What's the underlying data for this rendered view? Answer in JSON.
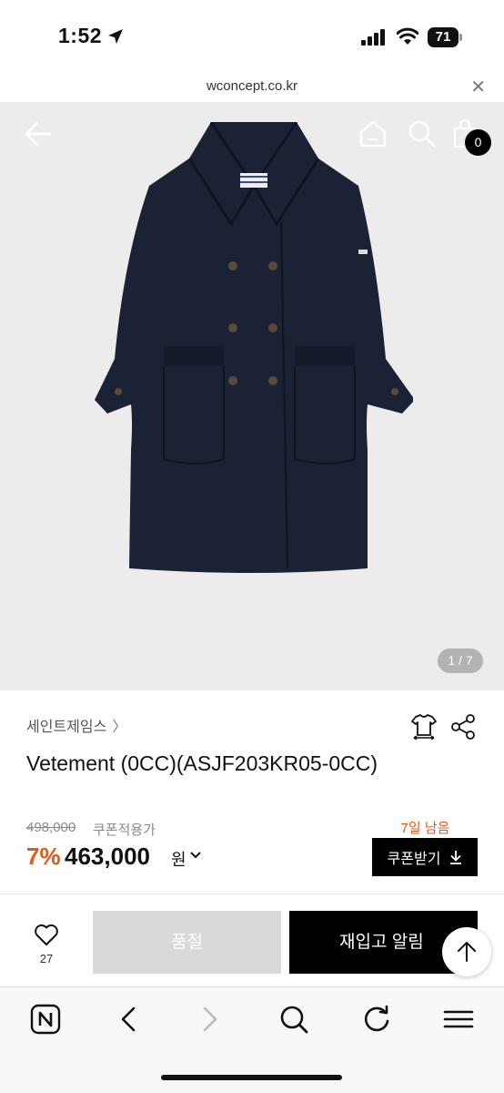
{
  "status": {
    "time": "1:52",
    "battery": "71"
  },
  "browser": {
    "url": "wconcept.co.kr",
    "close_glyph": "✕"
  },
  "gallery": {
    "cart_count": "0",
    "page_counter": "1 / 7"
  },
  "product": {
    "brand": "세인트제임스",
    "brand_chevron": "〉",
    "name": "Vetement (0CC)(ASJF203KR05-0CC)",
    "original_price": "498,000",
    "coupon_price_label": "쿠폰적용가",
    "discount": "7%",
    "price": "463,000",
    "currency": "원",
    "days_left": "7일 남음",
    "coupon_button": "쿠폰받기"
  },
  "actions": {
    "like_count": "27",
    "soldout_label": "품절",
    "restock_label": "재입고 알림"
  },
  "colors": {
    "accent": "#e25a1c",
    "black": "#000000",
    "disabled": "#d9d9d9",
    "coat": "#1c2236"
  },
  "icons": [
    "location-arrow-icon",
    "signal-icon",
    "wifi-icon",
    "battery-icon",
    "back-arrow-icon",
    "home-icon",
    "search-icon",
    "shopping-bag-icon",
    "hanger-icon",
    "share-icon",
    "chevron-down-icon",
    "download-icon",
    "heart-icon",
    "arrow-up-icon",
    "naver-icon",
    "back-icon",
    "forward-icon",
    "refresh-icon",
    "menu-icon"
  ]
}
